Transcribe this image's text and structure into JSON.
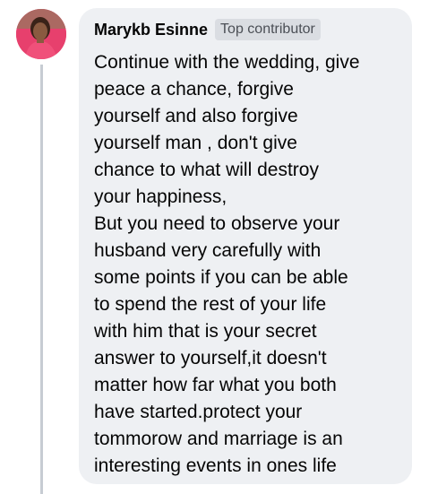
{
  "comment": {
    "author": {
      "name": "Marykb Esinne",
      "badge": "Top contributor",
      "avatar_icon": "profile-photo"
    },
    "text": "Continue with the wedding, give\npeace a chance, forgive\nyourself and also forgive\nyourself man , don't give\nchance to what will destroy\nyour    happiness,\nBut you need to observe your\nhusband very carefully with\nsome points if you can be able\nto spend the rest of your life\nwith him that is your secret\nanswer to yourself,it doesn't\nmatter how far what you both\nhave started.protect your\ntommorow and marriage is an\ninteresting events in ones life"
  },
  "colors": {
    "bubble_background": "#eef0f3",
    "badge_background": "#dadde2",
    "text": "#050505",
    "thread_line": "#c7ccd3",
    "avatar_background": "#e7406d"
  }
}
